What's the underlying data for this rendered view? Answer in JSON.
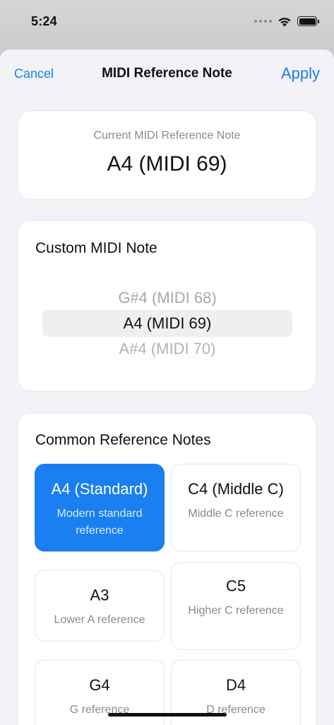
{
  "status_bar": {
    "time": "5:24"
  },
  "nav": {
    "cancel_label": "Cancel",
    "title": "MIDI Reference Note",
    "apply_label": "Apply"
  },
  "current": {
    "label": "Current MIDI Reference Note",
    "value": "A4 (MIDI 69)"
  },
  "custom": {
    "heading": "Custom MIDI Note",
    "picker": {
      "previous": "G#4 (MIDI 68)",
      "selected": "A4 (MIDI 69)",
      "next": "A#4 (MIDI 70)"
    }
  },
  "common": {
    "heading": "Common Reference Notes",
    "notes": [
      {
        "title": "A4 (Standard)",
        "description": "Modern standard reference",
        "selected": true
      },
      {
        "title": "C4 (Middle C)",
        "description": "Middle C reference",
        "selected": false
      },
      {
        "title": "A3",
        "description": "Lower A reference",
        "selected": false
      },
      {
        "title": "C5",
        "description": "Higher C reference",
        "selected": false
      },
      {
        "title": "G4",
        "description": "G reference",
        "selected": false
      },
      {
        "title": "D4",
        "description": "D reference",
        "selected": false
      }
    ]
  },
  "colors": {
    "accent": "#1a7ff0",
    "background": "#f2f2f7",
    "card": "#ffffff",
    "secondary_text": "#8a8a8e"
  },
  "icons": [
    "cellular-dots-icon",
    "wifi-icon",
    "battery-icon"
  ]
}
